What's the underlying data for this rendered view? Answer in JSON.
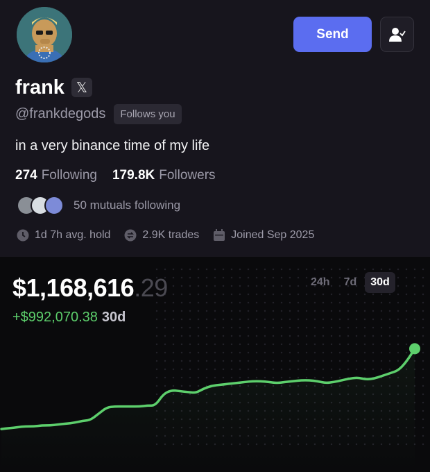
{
  "header": {
    "send_label": "Send"
  },
  "profile": {
    "name": "frank",
    "x_icon_glyph": "𝕏",
    "handle": "@frankdegods",
    "follows_you": "Follows you",
    "bio": "in a very binance time of my life",
    "following_count": "274",
    "following_label": "Following",
    "followers_count": "179.8K",
    "followers_label": "Followers",
    "mutuals_text": "50 mutuals following",
    "avg_hold": "1d 7h avg. hold",
    "trades": "2.9K trades",
    "joined": "Joined Sep 2025"
  },
  "portfolio": {
    "balance_main": "$1,168,616",
    "balance_cents": ".29",
    "pnl": "+$992,070.38",
    "pnl_period": "30d",
    "ranges": [
      "24h",
      "7d",
      "30d"
    ],
    "active_range": "30d"
  },
  "colors": {
    "accent": "#5b6df0",
    "gain": "#5dcf6c",
    "background": "#0a0a0c",
    "panel": "#17151d"
  },
  "chart_data": {
    "type": "line",
    "title": "",
    "xlabel": "",
    "ylabel": "",
    "values": [
      0.03,
      0.04,
      0.05,
      0.06,
      0.06,
      0.07,
      0.07,
      0.08,
      0.09,
      0.1,
      0.12,
      0.13,
      0.2,
      0.27,
      0.28,
      0.28,
      0.28,
      0.28,
      0.29,
      0.29,
      0.42,
      0.46,
      0.45,
      0.44,
      0.43,
      0.48,
      0.51,
      0.52,
      0.53,
      0.54,
      0.55,
      0.56,
      0.56,
      0.55,
      0.54,
      0.55,
      0.56,
      0.57,
      0.57,
      0.56,
      0.54,
      0.55,
      0.57,
      0.59,
      0.6,
      0.58,
      0.59,
      0.62,
      0.65,
      0.68,
      0.78,
      0.92
    ]
  }
}
